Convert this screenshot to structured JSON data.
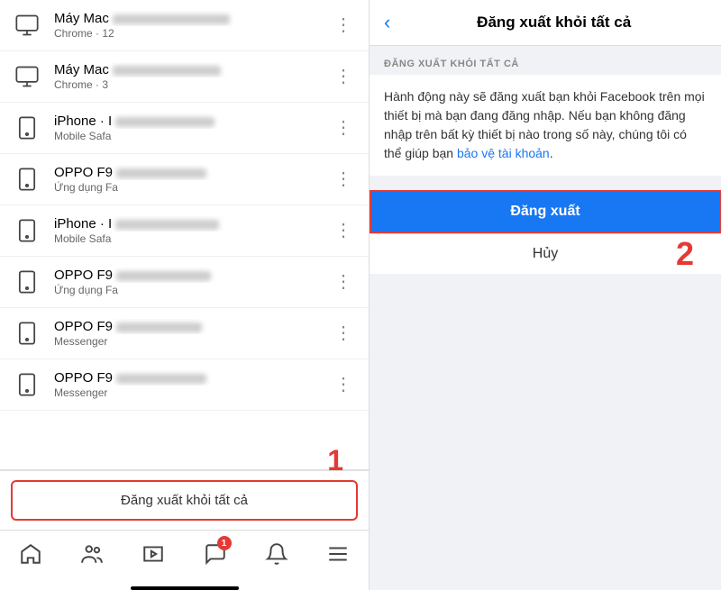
{
  "left": {
    "devices": [
      {
        "id": 1,
        "name": "Máy Mac",
        "sub": "Chrome · 12",
        "type": "desktop"
      },
      {
        "id": 2,
        "name": "Máy Mac",
        "sub": "Chrome · 3",
        "type": "desktop"
      },
      {
        "id": 3,
        "name": "iPhone · I",
        "sub": "Mobile Safa",
        "type": "phone"
      },
      {
        "id": 4,
        "name": "OPPO F9",
        "sub": "Ứng dụng Fa",
        "type": "phone"
      },
      {
        "id": 5,
        "name": "iPhone · I",
        "sub": "Mobile Safa",
        "type": "phone"
      },
      {
        "id": 6,
        "name": "OPPO F9",
        "sub": "Ứng dụng Fa",
        "type": "phone"
      },
      {
        "id": 7,
        "name": "OPPO F9",
        "sub": "Messenger",
        "type": "phone"
      },
      {
        "id": 8,
        "name": "OPPO F9",
        "sub": "Messenger",
        "type": "phone"
      }
    ],
    "logout_all_label": "Đăng xuất khỏi tất cả",
    "label_1": "1"
  },
  "nav": {
    "home_label": "home",
    "friends_label": "friends",
    "watch_label": "watch",
    "messages_label": "messages",
    "notifications_label": "notifications",
    "menu_label": "menu",
    "badge_count": "1"
  },
  "right": {
    "back_label": "‹",
    "title": "Đăng xuất khỏi tất cả",
    "section_label": "ĐĂNG XUẤT KHỎI TẤT CẢ",
    "description": "Hành động này sẽ đăng xuất bạn khỏi Facebook trên mọi thiết bị mà bạn đang đăng nhập. Nếu bạn không đăng nhập trên bất kỳ thiết bị nào trong số này, chúng tôi có thể giúp bạn ",
    "link_text": "bảo vệ tài khoản",
    "description_end": ".",
    "logout_btn": "Đăng xuất",
    "cancel_btn": "Hủy",
    "label_2": "2"
  }
}
